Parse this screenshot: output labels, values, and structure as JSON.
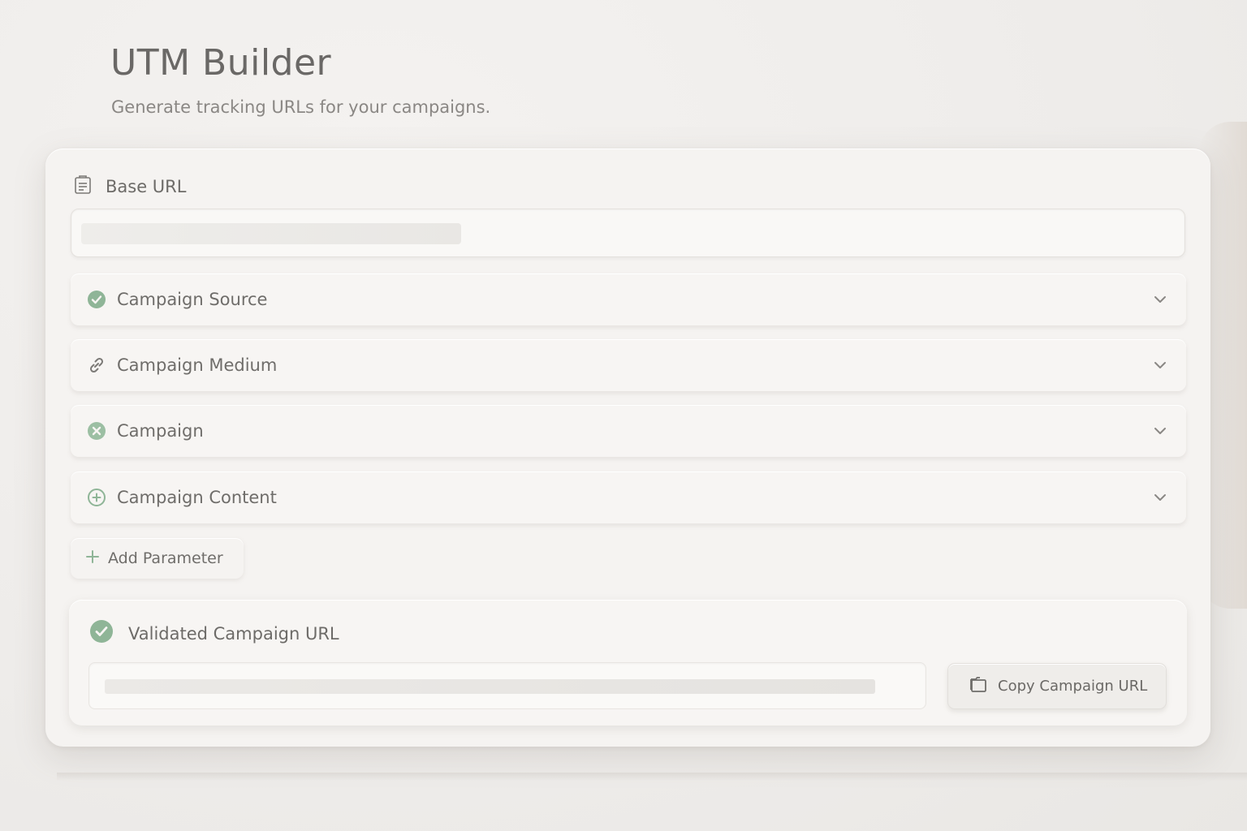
{
  "header": {
    "title": "UTM Builder",
    "subtitle": "Generate tracking URLs for your campaigns."
  },
  "base_url": {
    "label": "Base URL",
    "icon": "document-icon",
    "value": ""
  },
  "parameters": [
    {
      "label": "Campaign Source",
      "icon": "check-circle-icon",
      "status": "valid"
    },
    {
      "label": "Campaign Medium",
      "icon": "link-icon",
      "status": "neutral"
    },
    {
      "label": "Campaign",
      "icon": "x-circle-icon",
      "status": "invalid"
    },
    {
      "label": "Campaign Content",
      "icon": "plus-circle-icon",
      "status": "empty"
    }
  ],
  "add_parameter": {
    "label": "Add Parameter"
  },
  "result": {
    "label": "Validated Campaign URL",
    "value": "",
    "copy_label": "Copy Campaign URL"
  },
  "colors": {
    "accent_green": "#8fb597",
    "background": "#eeecea",
    "card": "#f5f3f1",
    "text": "#6c6a67"
  }
}
